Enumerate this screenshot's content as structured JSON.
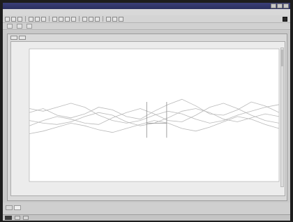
{
  "chart_data": {
    "type": "line",
    "title": "",
    "xlabel": "",
    "ylabel": "",
    "series": [
      {
        "values": [
          0.52,
          0.55,
          0.5,
          0.48,
          0.51,
          0.56,
          0.54,
          0.49,
          0.47,
          0.53,
          0.58,
          0.62,
          0.57,
          0.51,
          0.5,
          0.54,
          0.6,
          0.57,
          0.52
        ]
      },
      {
        "values": [
          0.42,
          0.46,
          0.49,
          0.47,
          0.44,
          0.43,
          0.48,
          0.52,
          0.55,
          0.51,
          0.46,
          0.45,
          0.5,
          0.56,
          0.59,
          0.55,
          0.5,
          0.46,
          0.44
        ]
      },
      {
        "values": [
          0.36,
          0.38,
          0.41,
          0.44,
          0.42,
          0.39,
          0.37,
          0.4,
          0.43,
          0.46,
          0.44,
          0.4,
          0.38,
          0.41,
          0.45,
          0.49,
          0.47,
          0.43,
          0.4
        ]
      },
      {
        "values": [
          0.46,
          0.44,
          0.43,
          0.45,
          0.49,
          0.52,
          0.5,
          0.45,
          0.42,
          0.44,
          0.48,
          0.53,
          0.55,
          0.52,
          0.47,
          0.45,
          0.48,
          0.51,
          0.49
        ]
      },
      {
        "values": [
          0.55,
          0.53,
          0.56,
          0.59,
          0.56,
          0.5,
          0.46,
          0.44,
          0.46,
          0.5,
          0.53,
          0.51,
          0.47,
          0.44,
          0.46,
          0.5,
          0.53,
          0.56,
          0.58
        ]
      }
    ],
    "ylim": [
      0,
      1
    ],
    "grid": false
  },
  "colors": {
    "trace": "#b9b9b9",
    "marker": "#8a8a8a",
    "plot_bg": "#ffffff"
  }
}
